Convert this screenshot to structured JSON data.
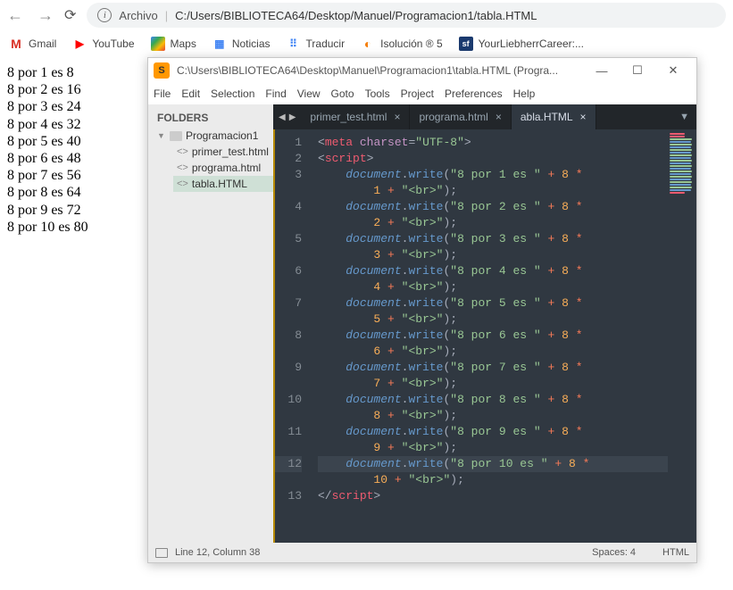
{
  "browser": {
    "addr_label": "Archivo",
    "addr_url": "C:/Users/BIBLIOTECA64/Desktop/Manuel/Programacion1/tabla.HTML"
  },
  "bookmarks": [
    {
      "label": "Gmail"
    },
    {
      "label": "YouTube"
    },
    {
      "label": "Maps"
    },
    {
      "label": "Noticias"
    },
    {
      "label": "Traducir"
    },
    {
      "label": "Isolución ® 5"
    },
    {
      "label": "YourLiebherrCareer:..."
    }
  ],
  "page_output": [
    "8 por 1 es 8",
    "8 por 2 es 16",
    "8 por 3 es 24",
    "8 por 4 es 32",
    "8 por 5 es 40",
    "8 por 6 es 48",
    "8 por 7 es 56",
    "8 por 8 es 64",
    "8 por 9 es 72",
    "8 por 10 es 80"
  ],
  "sublime": {
    "title": "C:\\Users\\BIBLIOTECA64\\Desktop\\Manuel\\Programacion1\\tabla.HTML (Progra...",
    "menu": [
      "File",
      "Edit",
      "Selection",
      "Find",
      "View",
      "Goto",
      "Tools",
      "Project",
      "Preferences",
      "Help"
    ],
    "folders_h": "FOLDERS",
    "root_folder": "Programacion1",
    "files": [
      "primer_test.html",
      "programa.html",
      "tabla.HTML"
    ],
    "selected_file_index": 2,
    "tabs": [
      {
        "label": "primer_test.html",
        "active": false
      },
      {
        "label": "programa.html",
        "active": false
      },
      {
        "label": "abla.HTML",
        "active": true
      }
    ],
    "status": {
      "pos": "Line 12, Column 38",
      "spaces": "Spaces: 4",
      "lang": "HTML"
    },
    "code": {
      "line_count": 13,
      "current_line": 12,
      "meta_tag": "meta",
      "meta_attr": "charset",
      "meta_val": "\"UTF-8\"",
      "script_tag": "script",
      "obj": "document",
      "fn": "write",
      "str_prefix": "\"8 por ",
      "str_mid": " es \"",
      "plus": "+",
      "mult": "*",
      "eight": "8",
      "br_str": "\"<br>\"",
      "nums": [
        "1",
        "2",
        "3",
        "4",
        "5",
        "6",
        "7",
        "8",
        "9",
        "10"
      ]
    }
  }
}
